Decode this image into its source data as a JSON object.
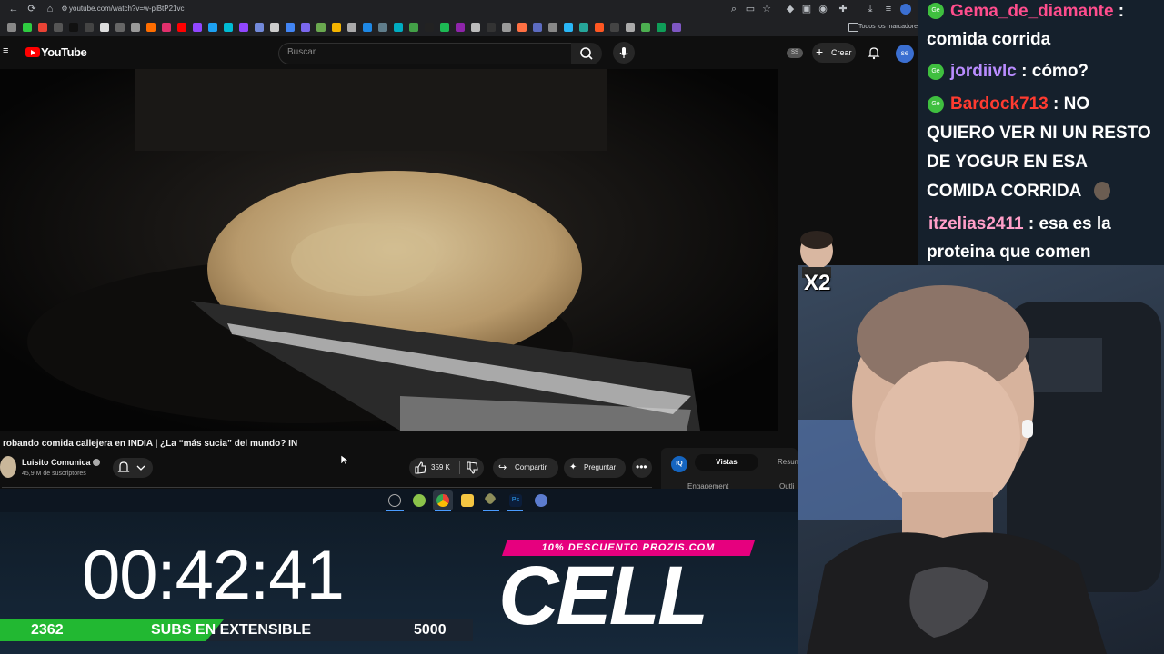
{
  "browser": {
    "url": "youtube.com/watch?v=w-piBtP21vc",
    "bookmarks_folder": "Todos los marcadores"
  },
  "youtube": {
    "logo_text": "YouTube",
    "search_placeholder": "Buscar",
    "ss_badge": "SS",
    "create_label": "Crear",
    "avatar_initials": "se"
  },
  "video": {
    "title": "robando comida callejera en INDIA | ¿La “más sucia” del mundo? IN",
    "channel_name": "Luisito Comunica",
    "channel_subs": "45,9 M de suscriptores",
    "likes": "359 K",
    "share_label": "Compartir",
    "ask_label": "Preguntar"
  },
  "side_panel": {
    "iq_label": "IQ",
    "tab_views": "Vistas",
    "tab_summary": "Resum",
    "engagement": "Engagement",
    "outline": "Outli"
  },
  "chat": {
    "messages": [
      {
        "user": "Gema_de_diamante",
        "color": "#ff4d8d",
        "text_lines": [
          "comida corrida"
        ]
      },
      {
        "user": "jordiivlc",
        "color": "#b98cff",
        "text": "cómo?"
      },
      {
        "user": "Bardock713",
        "color": "#ff3b30",
        "text_lines": [
          "NO",
          "QUIERO VER NI UN RESTO",
          "DE YOGUR EN ESA",
          "COMIDA CORRIDA"
        ]
      },
      {
        "user": "itzelias2411",
        "color": "#ff9ec8",
        "text_lines": [
          "esa es la",
          "proteina que comen"
        ]
      }
    ]
  },
  "emote_multiplier": "X2",
  "stream_overlay": {
    "timer": "00:42:41",
    "subs_current": "2362",
    "subs_label": "SUBS EN EXTENSIBLE",
    "subs_goal": "5000",
    "subs_progress_fraction": 0.4724,
    "promo": "10% DESCUENTO PROZIS.COM",
    "brand": "CELL"
  },
  "colors": {
    "youtube_red": "#ff0000",
    "progress_green": "#22b832",
    "promo_pink": "#e6007e"
  }
}
